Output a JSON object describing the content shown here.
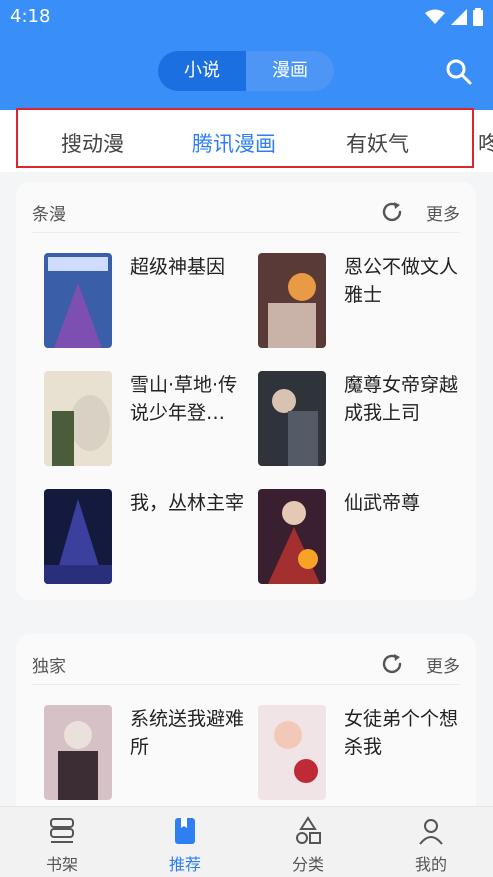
{
  "status": {
    "time": "4:18"
  },
  "header": {
    "segments": [
      {
        "label": "小说"
      },
      {
        "label": "漫画"
      }
    ],
    "search_icon": "search-icon"
  },
  "source_tabs": [
    {
      "label": "搜动漫"
    },
    {
      "label": "腾讯漫画"
    },
    {
      "label": "有妖气"
    },
    {
      "label": "咚"
    }
  ],
  "sections": [
    {
      "title": "条漫",
      "more": "更多",
      "items": [
        {
          "title": "超级神基因"
        },
        {
          "title": "恩公不做文人雅士"
        },
        {
          "title": "雪山·草地·传说少年登…"
        },
        {
          "title": "魔尊女帝穿越成我上司"
        },
        {
          "title": "我，丛林主宰"
        },
        {
          "title": "仙武帝尊"
        }
      ]
    },
    {
      "title": "独家",
      "more": "更多",
      "items": [
        {
          "title": "系统送我避难所"
        },
        {
          "title": "女徒弟个个想杀我"
        }
      ]
    }
  ],
  "bottom_nav": [
    {
      "label": "书架"
    },
    {
      "label": "推荐"
    },
    {
      "label": "分类"
    },
    {
      "label": "我的"
    }
  ],
  "colors": {
    "primary": "#3a8ef7",
    "accent": "#2f7ff0",
    "highlight": "#e0232e"
  }
}
